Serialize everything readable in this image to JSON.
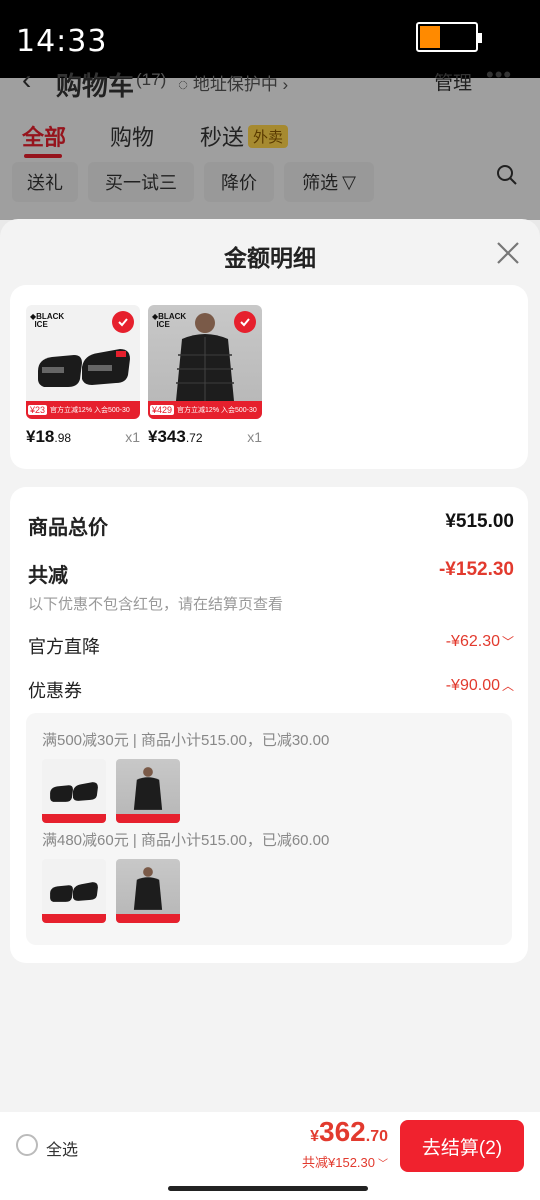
{
  "status": {
    "time": "14:33",
    "battery_level": 0.35,
    "battery_color": "#ff8a00"
  },
  "background_page": {
    "title": "购物车",
    "count": "(17)",
    "address_label": "地址保护中",
    "manage": "管理",
    "more": "•••",
    "tabs": [
      {
        "label": "全部",
        "active": true
      },
      {
        "label": "购物",
        "active": false
      },
      {
        "label": "秒送",
        "badge": "外卖",
        "active": false
      }
    ],
    "chips": [
      "送礼",
      "买一试三",
      "降价",
      "筛选"
    ]
  },
  "sheet": {
    "title": "金额明细",
    "products": [
      {
        "kind": "sock",
        "brand_lines": [
          "BLACK",
          "ICE"
        ],
        "promo_price": "¥23",
        "promo_text": "官方立减12% 入会500-30",
        "price_int": "¥18",
        "price_dec": ".98",
        "qty": "x1",
        "checked": true
      },
      {
        "kind": "jacket",
        "brand_lines": [
          "BLACK",
          "ICE"
        ],
        "promo_price": "¥429",
        "promo_text": "官方立减12% 入会500-30",
        "price_int": "¥343",
        "price_dec": ".72",
        "qty": "x1",
        "checked": true
      }
    ],
    "summary": {
      "total_label": "商品总价",
      "total_value": "¥515.00",
      "discount_label": "共减",
      "discount_value": "-¥152.30",
      "discount_note": "以下优惠不包含红包，请在结算页查看",
      "official_label": "官方直降",
      "official_value": "-¥62.30",
      "coupon_label": "优惠券",
      "coupon_value": "-¥90.00"
    },
    "coupons": [
      {
        "text": "满500减30元 | 商品小计515.00，已减30.00"
      },
      {
        "text": "满480减60元 | 商品小计515.00，已减60.00"
      }
    ]
  },
  "bottom_bar": {
    "select_all": "全选",
    "currency": "¥",
    "total_int": "362",
    "total_dec": ".70",
    "saved": "共减¥152.30",
    "checkout": "去结算(2)"
  },
  "colors": {
    "accent_red": "#e6202d",
    "price_red": "#e23a2e"
  }
}
